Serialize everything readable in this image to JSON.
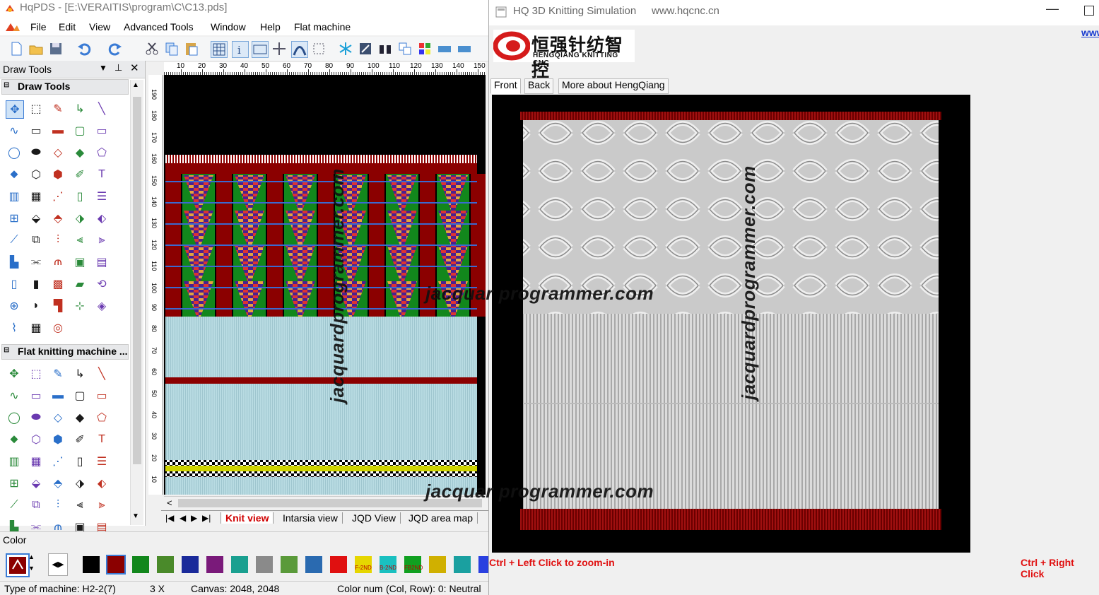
{
  "app": {
    "title": "HqPDS - [E:\\VERAITIS\\program\\C\\C13.pds]",
    "menu": [
      "File",
      "Edit",
      "View",
      "Advanced Tools",
      "Window",
      "Help",
      "Flat machine"
    ],
    "dock_title": "Draw Tools",
    "section_draw": "Draw Tools",
    "section_flat": "Flat knitting machine ...",
    "ruler_h": [
      "10",
      "20",
      "30",
      "40",
      "50",
      "60",
      "70",
      "80",
      "90",
      "100",
      "110",
      "120",
      "130",
      "140",
      "150"
    ],
    "ruler_v": [
      "190",
      "180",
      "170",
      "160",
      "150",
      "140",
      "130",
      "120",
      "110",
      "100",
      "90",
      "80",
      "70",
      "60",
      "50",
      "40",
      "30",
      "20",
      "10"
    ],
    "view_tabs": [
      "Knit view",
      "Intarsia view",
      "JQD View",
      "JQD area map"
    ],
    "active_view_tab": "Knit view",
    "color_label": "Color",
    "color_swatch_labels": [
      "F-2ND",
      "B-2ND",
      "FB2ND"
    ],
    "status": {
      "machine": "Type of machine: H2-2(7)",
      "zoom": "3 X",
      "canvas": "Canvas: 2048, 2048",
      "color_num": "Color num",
      "colrow": "(Col, Row): 0: Neutral (n"
    }
  },
  "sim": {
    "title": "HQ 3D Knitting Simulation",
    "url": "www.hqcnc.cn",
    "link_partial": "www",
    "logo_cn": "恒强针纺智控",
    "logo_en": "HENGQIANG KNITTING CNC",
    "tabs": [
      "Front",
      "Back",
      "More about HengQiang"
    ],
    "hint_left": "Ctrl + Left Click to zoom-in",
    "hint_right": "Ctrl + Right Click"
  },
  "watermark": "jacquardprogrammer.com",
  "watermark_partial": "jacquar    programmer.com",
  "colors": {
    "knit_red": "#8b0000",
    "knit_green": "#12871c",
    "knit_lightblue": "#b5d9e0",
    "knit_gray": "#cfcfcf",
    "hint_red": "#e01010"
  }
}
